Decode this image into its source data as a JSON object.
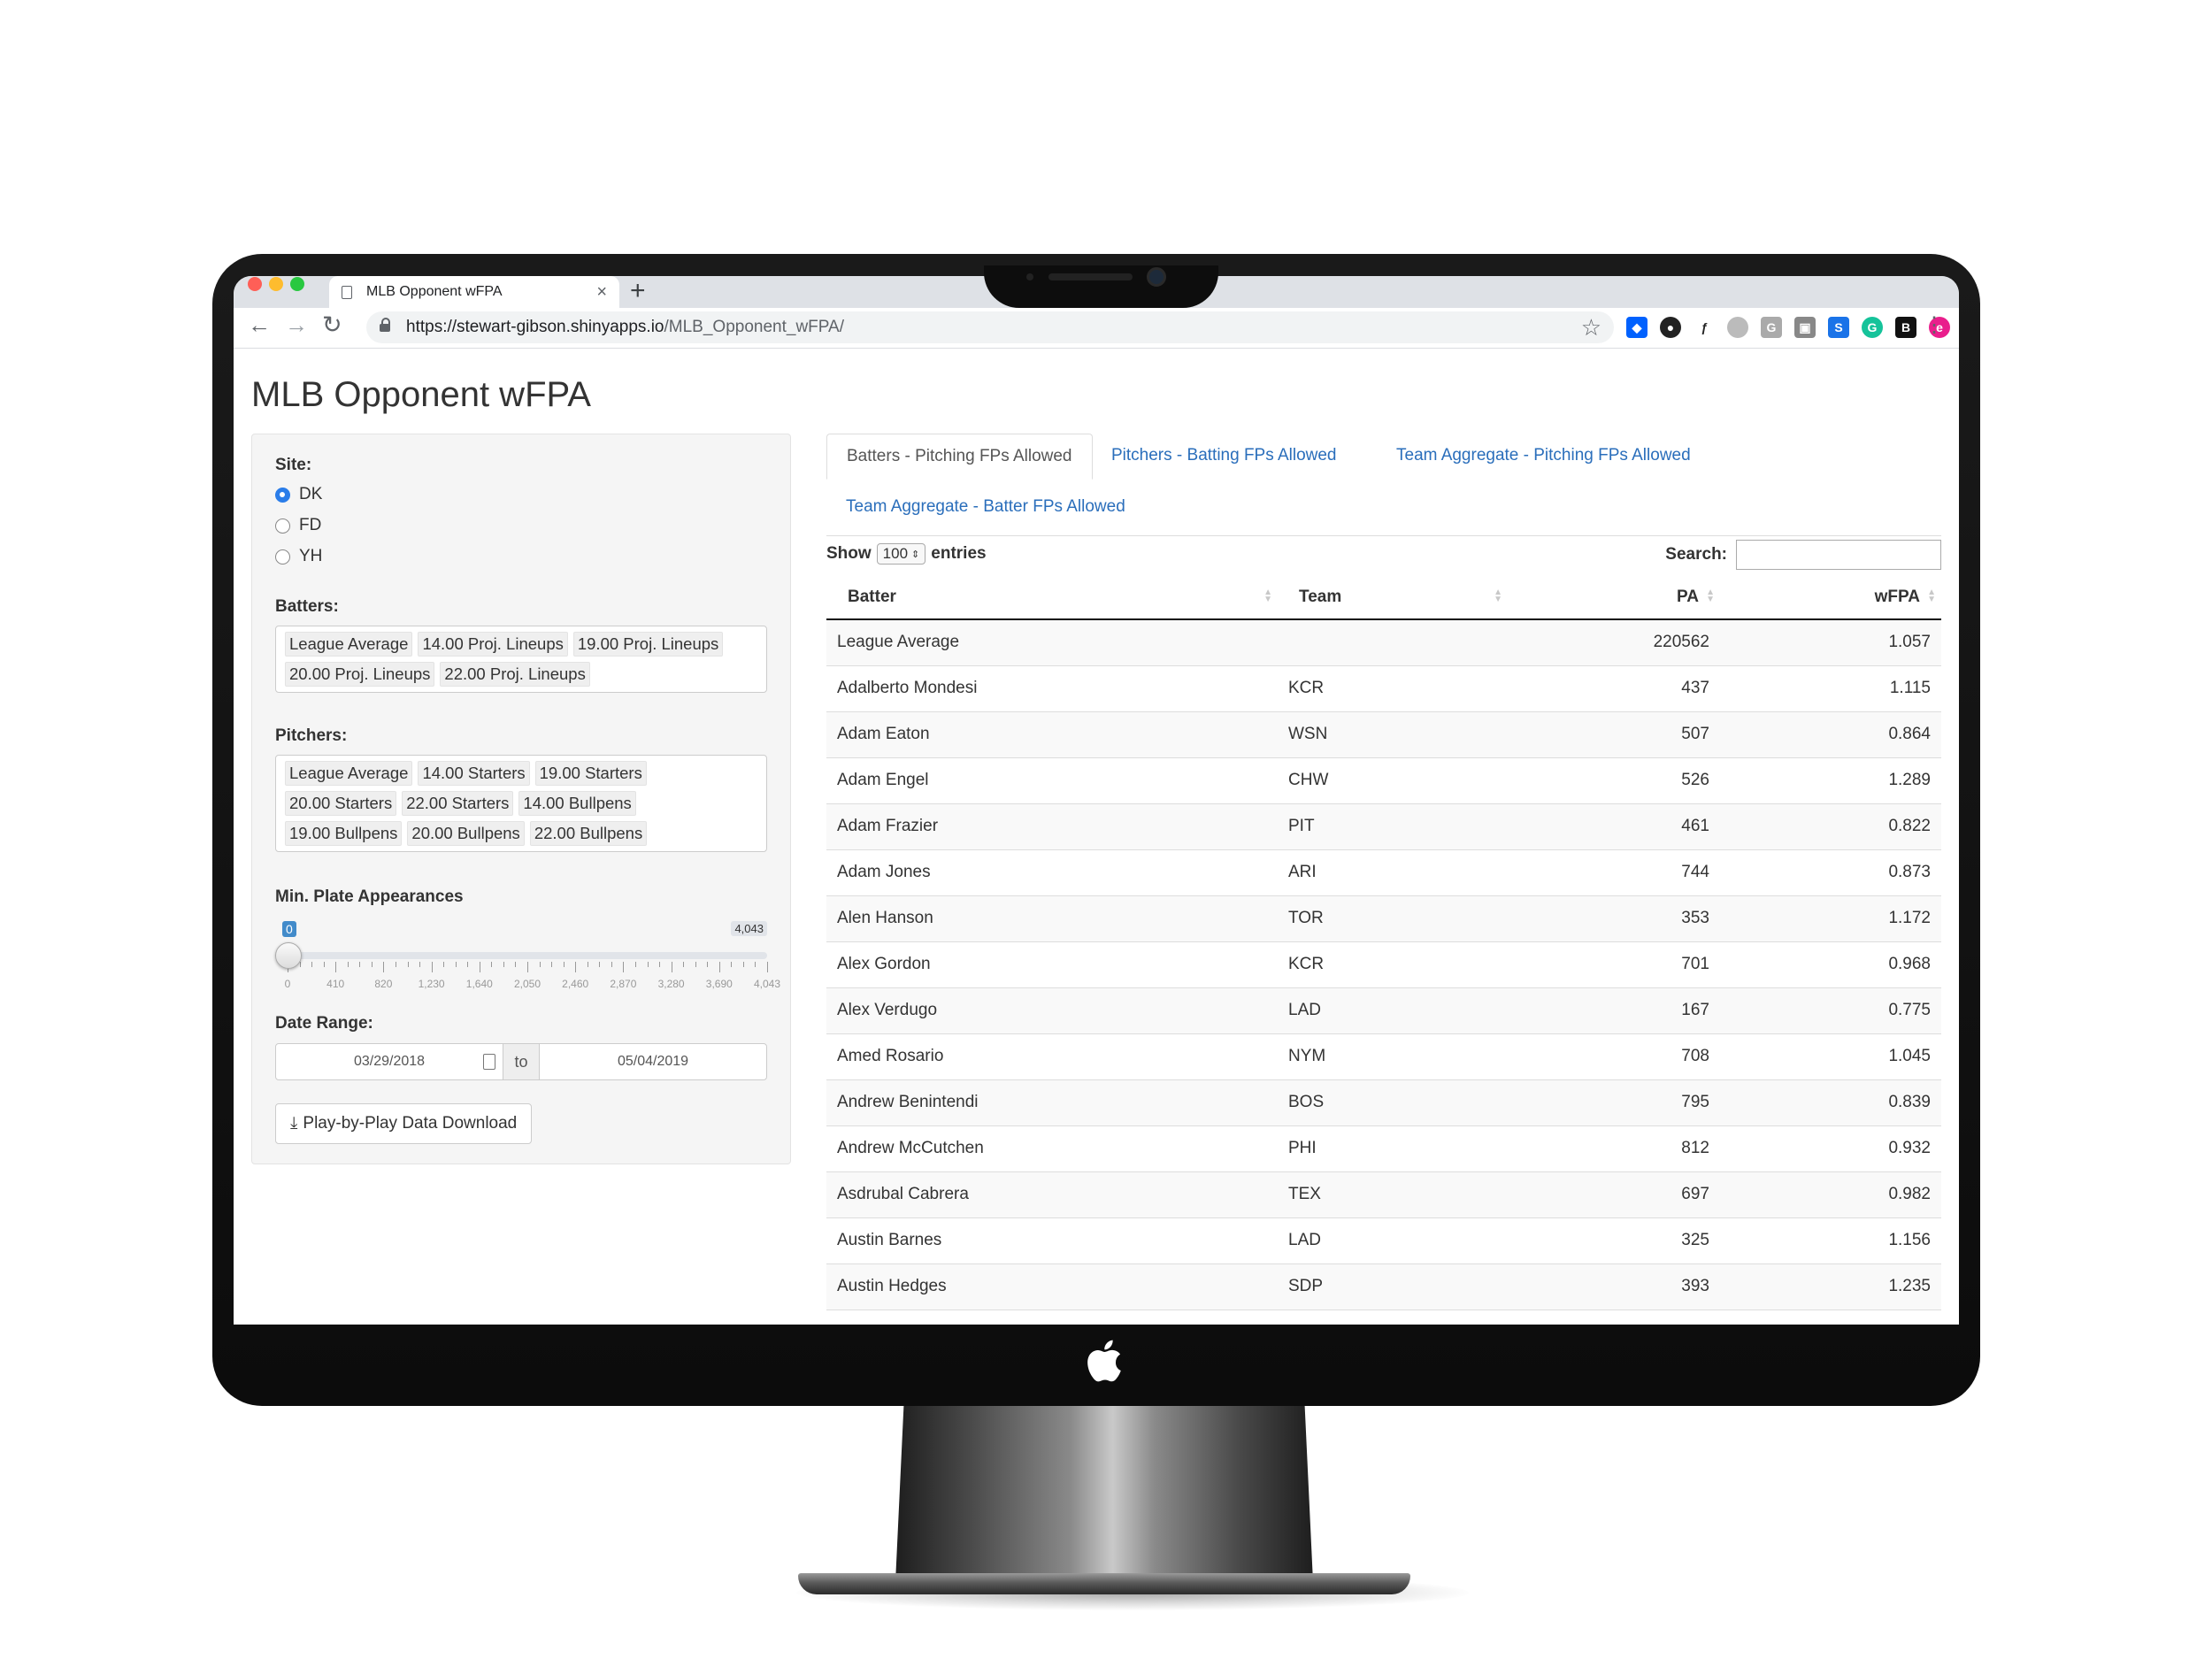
{
  "browser": {
    "tab_title": "MLB Opponent wFPA",
    "tab_close": "×",
    "new_tab": "+",
    "url_host": "https://stewart-gibson.shinyapps.io",
    "url_path": "/MLB_Opponent_wFPA/"
  },
  "page": {
    "title": "MLB Opponent wFPA"
  },
  "sidebar": {
    "site_label": "Site:",
    "site_options": [
      "DK",
      "FD",
      "YH"
    ],
    "site_selected": "DK",
    "batters_label": "Batters:",
    "batters": [
      "League Average",
      "14.00 Proj. Lineups",
      "19.00 Proj. Lineups",
      "20.00 Proj. Lineups",
      "22.00 Proj. Lineups"
    ],
    "pitchers_label": "Pitchers:",
    "pitchers": [
      "League Average",
      "14.00 Starters",
      "19.00 Starters",
      "20.00 Starters",
      "22.00 Starters",
      "14.00 Bullpens",
      "19.00 Bullpens",
      "20.00 Bullpens",
      "22.00 Bullpens"
    ],
    "min_pa_label": "Min. Plate Appearances",
    "slider": {
      "min": 0,
      "max": 4043,
      "value": 0,
      "value_label": "0",
      "max_label": "4,043",
      "ticks": [
        "0",
        "410",
        "820",
        "1,230",
        "1,640",
        "2,050",
        "2,460",
        "2,870",
        "3,280",
        "3,690",
        "4,043"
      ]
    },
    "date_range_label": "Date Range:",
    "date_start": "03/29/2018",
    "date_sep": "to",
    "date_end": "05/04/2019",
    "download_label": "Play-by-Play Data Download"
  },
  "main": {
    "tabs": [
      "Batters - Pitching FPs Allowed",
      "Pitchers - Batting FPs Allowed",
      "Team Aggregate - Pitching FPs Allowed",
      "Team Aggregate - Batter FPs Allowed"
    ],
    "show_label": "Show",
    "entries_value": "100",
    "entries_label": "entries",
    "search_label": "Search:",
    "columns": [
      "Batter",
      "Team",
      "PA",
      "wFPA"
    ],
    "rows": [
      [
        "League Average",
        "",
        "220562",
        "1.057"
      ],
      [
        "Adalberto Mondesi",
        "KCR",
        "437",
        "1.115"
      ],
      [
        "Adam Eaton",
        "WSN",
        "507",
        "0.864"
      ],
      [
        "Adam Engel",
        "CHW",
        "526",
        "1.289"
      ],
      [
        "Adam Frazier",
        "PIT",
        "461",
        "0.822"
      ],
      [
        "Adam Jones",
        "ARI",
        "744",
        "0.873"
      ],
      [
        "Alen Hanson",
        "TOR",
        "353",
        "1.172"
      ],
      [
        "Alex Gordon",
        "KCR",
        "701",
        "0.968"
      ],
      [
        "Alex Verdugo",
        "LAD",
        "167",
        "0.775"
      ],
      [
        "Amed Rosario",
        "NYM",
        "708",
        "1.045"
      ],
      [
        "Andrew Benintendi",
        "BOS",
        "795",
        "0.839"
      ],
      [
        "Andrew McCutchen",
        "PHI",
        "812",
        "0.932"
      ],
      [
        "Asdrubal Cabrera",
        "TEX",
        "697",
        "0.982"
      ],
      [
        "Austin Barnes",
        "LAD",
        "325",
        "1.156"
      ],
      [
        "Austin Hedges",
        "SDP",
        "393",
        "1.235"
      ]
    ]
  },
  "icons": {
    "back": "back-arrow-icon",
    "forward": "forward-arrow-icon",
    "reload": "reload-icon",
    "lock": "lock-icon",
    "star": "star-icon",
    "menu": "kebab-menu-icon",
    "download": "download-icon",
    "calendar": "calendar-icon"
  },
  "colors": {
    "accent": "#2b7de9",
    "link": "#2a6ebb",
    "slider_badge": "#428bca"
  }
}
